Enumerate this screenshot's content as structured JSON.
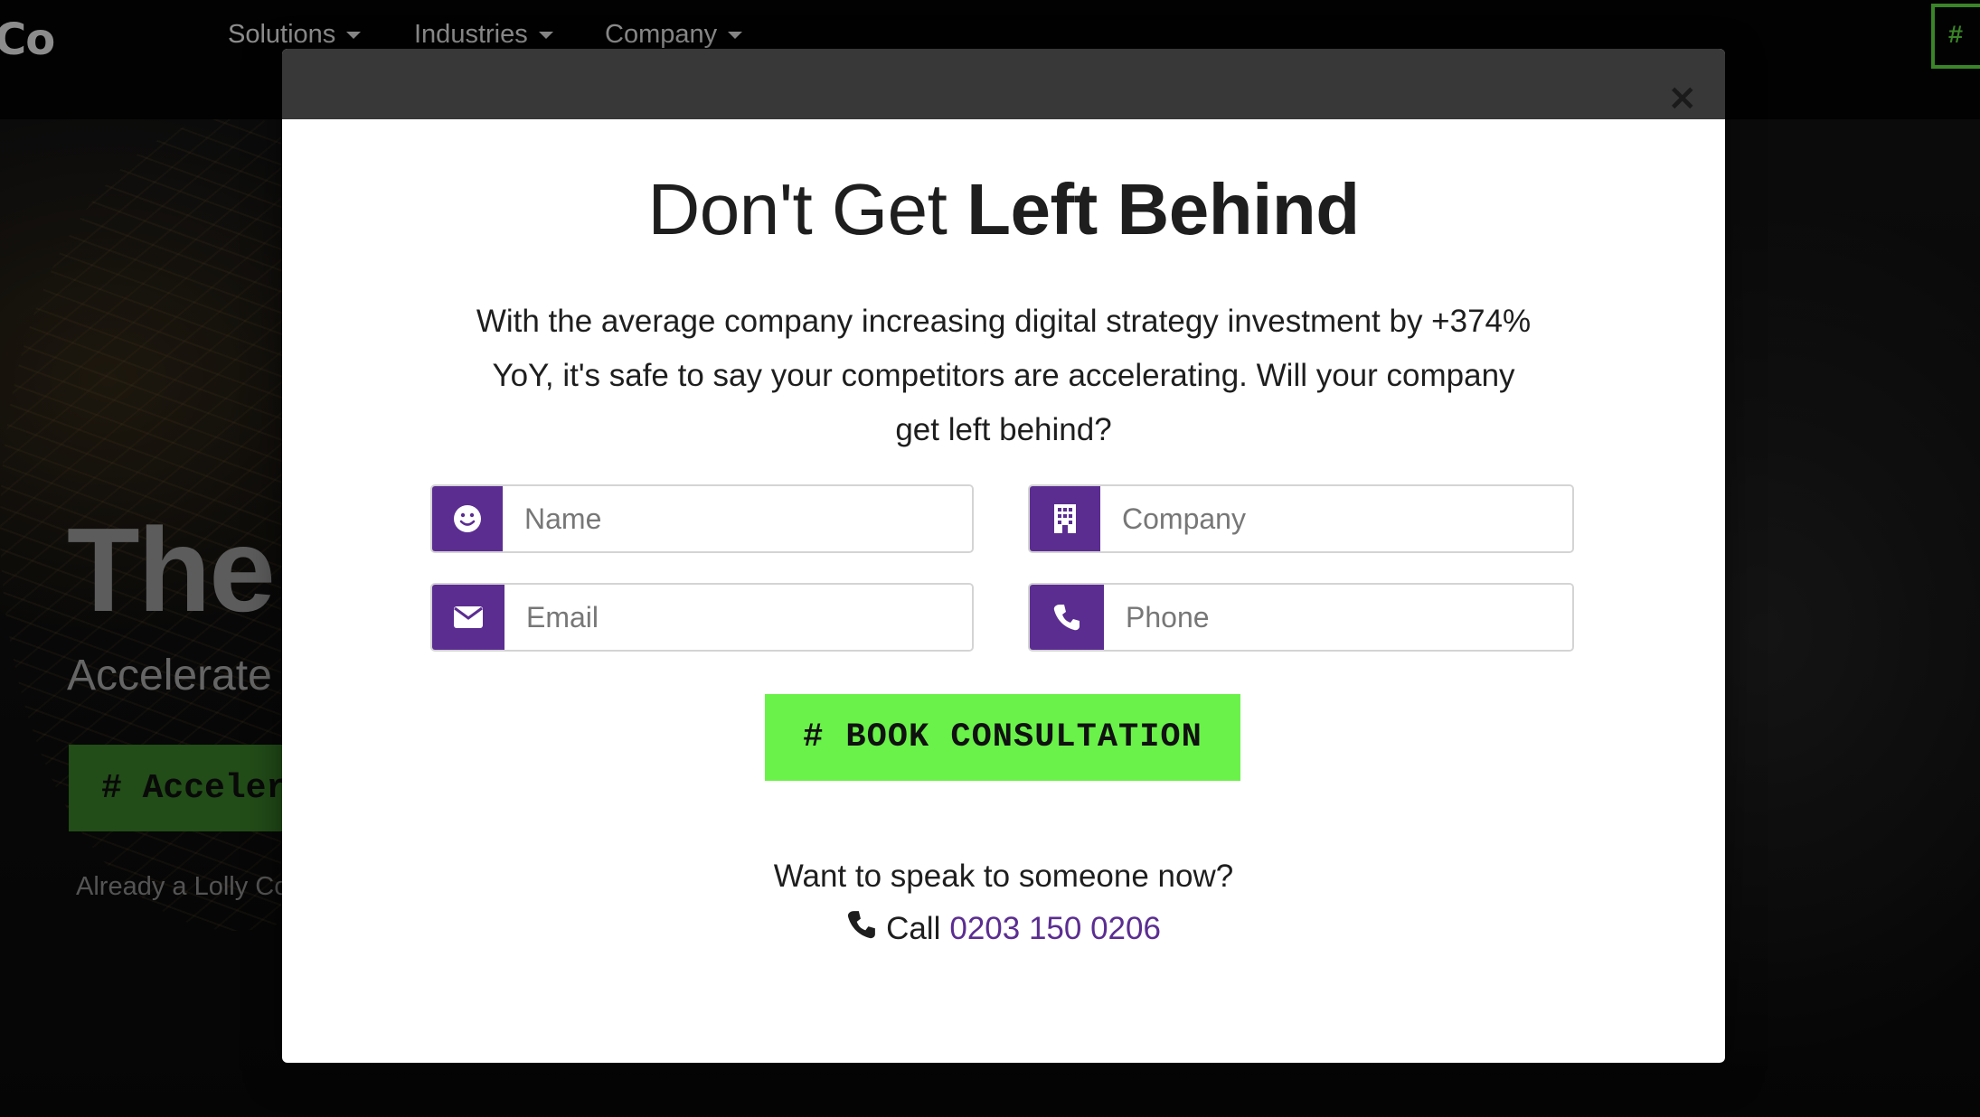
{
  "nav": {
    "logo": "Co",
    "items": [
      {
        "label": "Solutions"
      },
      {
        "label": "Industries"
      },
      {
        "label": "Company"
      }
    ],
    "cta_symbol": "#"
  },
  "hero": {
    "title": "The",
    "subtitle": "Accelerate",
    "button_label": "# Acceler",
    "small_text": "Already a Lolly Co"
  },
  "modal": {
    "close_symbol": "×",
    "title_regular": "Don't Get ",
    "title_bold": "Left Behind",
    "description": "With the average company increasing digital strategy investment by +374% YoY, it's safe to say your competitors are accelerating. Will your company get left behind?",
    "fields": {
      "name": {
        "placeholder": "Name",
        "icon": "smiley-icon"
      },
      "company": {
        "placeholder": "Company",
        "icon": "building-icon"
      },
      "email": {
        "placeholder": "Email",
        "icon": "envelope-icon"
      },
      "phone": {
        "placeholder": "Phone",
        "icon": "phone-icon"
      }
    },
    "submit": {
      "symbol": "#",
      "label": "BOOK CONSULTATION"
    },
    "speak_text": "Want to speak to someone now?",
    "call_label": "Call",
    "phone_number": "0203 150 0206"
  },
  "colors": {
    "accent_purple": "#5b2d91",
    "accent_green": "#6af24a",
    "modal_header": "#383838"
  }
}
